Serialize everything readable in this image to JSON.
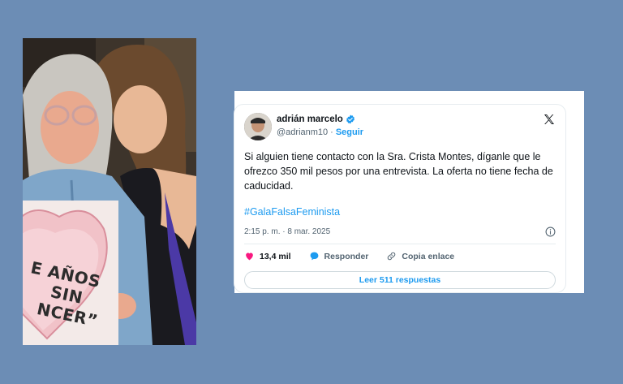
{
  "photo": {
    "sign_lines": [
      "E AÑOS",
      "SIN",
      "NCER”"
    ]
  },
  "tweet": {
    "display_name": "adrián marcelo",
    "handle": "@adrianm10",
    "separator": "·",
    "follow_label": "Seguir",
    "body": "Si alguien tiene contacto con la Sra. Crista Montes, díganle que le ofrezco 350 mil pesos por una entrevista. La oferta no tiene fecha de caducidad.",
    "hashtag": "#GalaFalsaFeminista",
    "timestamp": "2:15 p. m. · 8 mar. 2025",
    "likes": "13,4 mil",
    "reply_label": "Responder",
    "copy_link_label": "Copia enlace",
    "read_replies_label": "Leer 511 respuestas"
  },
  "colors": {
    "background": "#6c8db5",
    "accent": "#1d9bf0",
    "like": "#f91880",
    "text": "#0f1419",
    "muted": "#536471"
  },
  "icons": [
    "verified-badge-icon",
    "x-logo-icon",
    "info-icon",
    "heart-icon",
    "reply-bubble-icon",
    "link-icon"
  ]
}
